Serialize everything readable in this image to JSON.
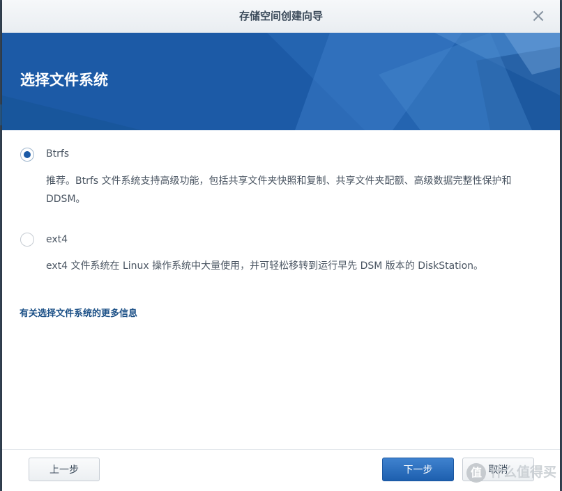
{
  "window": {
    "title": "存储空间创建向导"
  },
  "banner": {
    "title": "选择文件系统"
  },
  "options": [
    {
      "label": "Btrfs",
      "checked": true,
      "description": "推荐。Btrfs 文件系统支持高级功能，包括共享文件夹快照和复制、共享文件夹配额、高级数据完整性保护和 DDSM。"
    },
    {
      "label": "ext4",
      "checked": false,
      "description": "ext4 文件系统在 Linux 操作系统中大量使用，并可轻松移转到运行早先 DSM 版本的 DiskStation。"
    }
  ],
  "more_info_link": "有关选择文件系统的更多信息",
  "buttons": {
    "prev": "上一步",
    "next": "下一步",
    "cancel": "取消"
  },
  "watermark": {
    "text": "什么值得买",
    "icon_text": "值"
  },
  "colors": {
    "accent": "#1c5aa6",
    "link": "#1a4f86",
    "text": "#4a5562"
  }
}
